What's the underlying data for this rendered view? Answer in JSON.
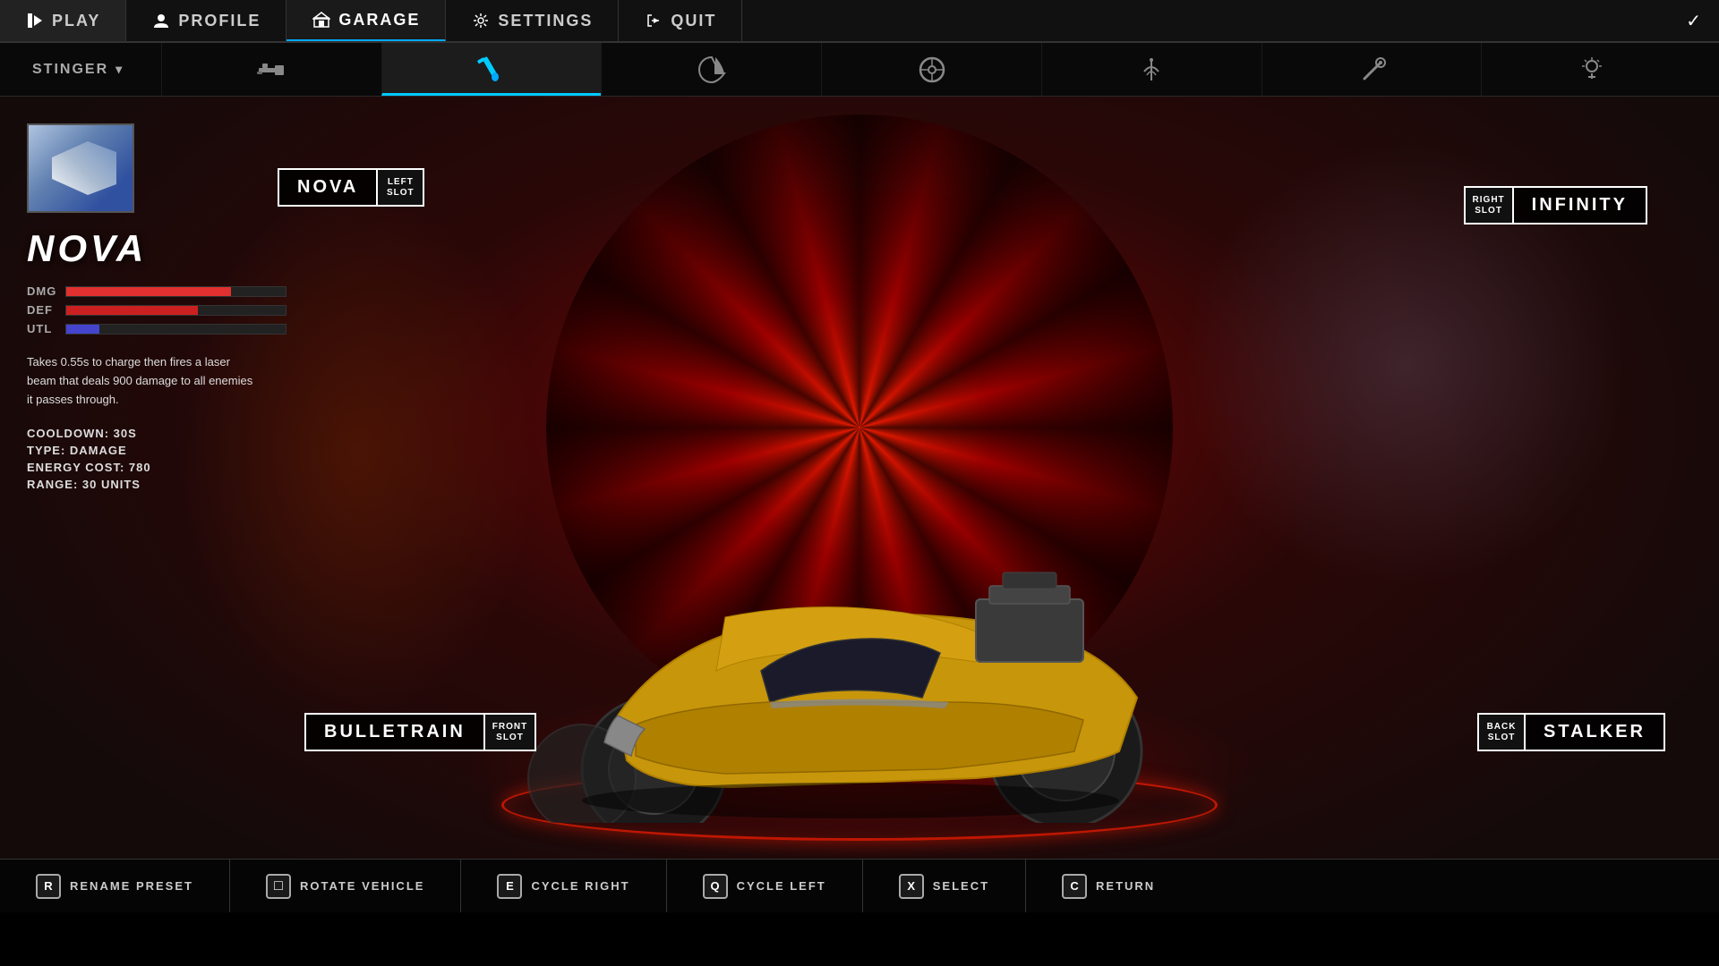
{
  "nav": {
    "items": [
      {
        "id": "play",
        "label": "PLAY",
        "icon": "play-icon",
        "active": false
      },
      {
        "id": "profile",
        "label": "PROFILE",
        "icon": "profile-icon",
        "active": false
      },
      {
        "id": "garage",
        "label": "GARAGE",
        "icon": "garage-icon",
        "active": true
      },
      {
        "id": "settings",
        "label": "SETTINGS",
        "icon": "settings-icon",
        "active": false
      },
      {
        "id": "quit",
        "label": "QUIT",
        "icon": "quit-icon",
        "active": false
      }
    ],
    "checkmark": "✓"
  },
  "toolbar": {
    "vehicle_name": "STINGER",
    "icons": [
      {
        "id": "paint",
        "label": "Paint",
        "active": true
      },
      {
        "id": "sticker",
        "label": "Sticker",
        "active": false
      },
      {
        "id": "wheel",
        "label": "Wheel",
        "active": false
      },
      {
        "id": "antenna",
        "label": "Antenna",
        "active": false
      },
      {
        "id": "exhaust",
        "label": "Exhaust",
        "active": false
      },
      {
        "id": "light",
        "label": "Light",
        "active": false
      }
    ]
  },
  "weapon_info": {
    "name": "NOVA",
    "stats": {
      "dmg_label": "DMG",
      "def_label": "DEF",
      "utl_label": "UTL",
      "dmg_pct": 75,
      "def_pct": 60,
      "utl_pct": 15
    },
    "description": "Takes 0.55s to charge then fires a laser beam that deals 900 damage to all enemies it passes through.",
    "cooldown": "COOLDOWN: 30s",
    "type": "TYPE: DAMAGE",
    "energy_cost": "ENERGY COST: 780",
    "range": "RANGE: 30 units"
  },
  "slots": {
    "left": {
      "weapon": "NOVA",
      "slot_line1": "LEFT",
      "slot_line2": "SLOT"
    },
    "right": {
      "weapon": "INFINITY",
      "slot_line1": "RIGHT",
      "slot_line2": "SLOT"
    },
    "front": {
      "weapon": "BULLETRAIN",
      "slot_line1": "FRONT",
      "slot_line2": "SLOT"
    },
    "back": {
      "weapon": "STALKER",
      "slot_line1": "BACK",
      "slot_line2": "SLOT"
    }
  },
  "bottom_bar": {
    "actions": [
      {
        "key": "R",
        "label": "RENAME PRESET"
      },
      {
        "key": "□",
        "label": "ROTATE VEHICLE"
      },
      {
        "key": "E",
        "label": "CYCLE RIGHT"
      },
      {
        "key": "Q",
        "label": "CYCLE LEFT"
      },
      {
        "key": "X",
        "label": "SELECT"
      },
      {
        "key": "C",
        "label": "RETURN"
      }
    ]
  }
}
